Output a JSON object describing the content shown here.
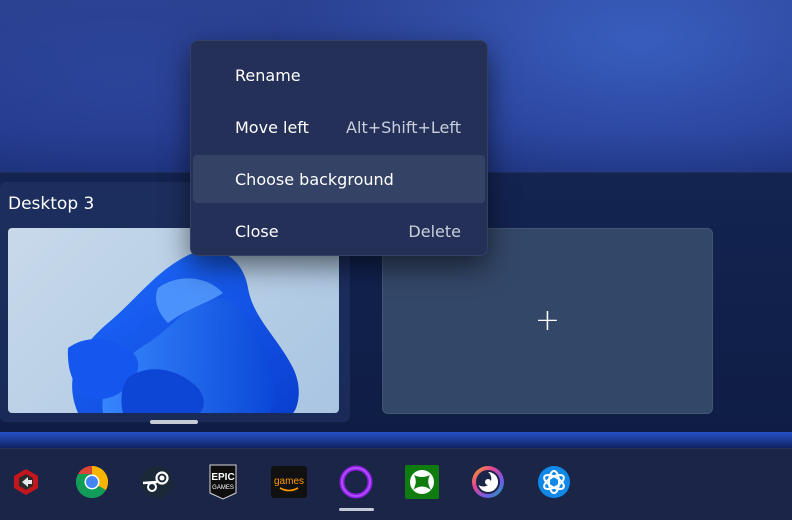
{
  "context_menu": {
    "items": [
      {
        "label": "Rename",
        "shortcut": ""
      },
      {
        "label": "Move left",
        "shortcut": "Alt+Shift+Left"
      },
      {
        "label": "Choose background",
        "shortcut": ""
      },
      {
        "label": "Close",
        "shortcut": "Delete"
      }
    ],
    "highlighted_index": 2
  },
  "task_view": {
    "desktop": {
      "title": "Desktop 3"
    },
    "new_desktop": {
      "symbol": "+"
    }
  },
  "taskbar": {
    "icons": [
      {
        "name": "red-app-icon"
      },
      {
        "name": "chrome-icon"
      },
      {
        "name": "steam-icon"
      },
      {
        "name": "epic-games-icon",
        "text_top": "EPIC",
        "text_bottom": "GAMES"
      },
      {
        "name": "amazon-games-icon",
        "text": "games"
      },
      {
        "name": "cortana-icon"
      },
      {
        "name": "xbox-icon"
      },
      {
        "name": "ubisoft-icon"
      },
      {
        "name": "battlenet-icon"
      }
    ],
    "active_index": 5
  },
  "colors": {
    "menu_bg": "#243058",
    "menu_highlight": "#344365",
    "taskbar_bg": "#1a2548",
    "accent_blue": "#1f5fe0"
  }
}
